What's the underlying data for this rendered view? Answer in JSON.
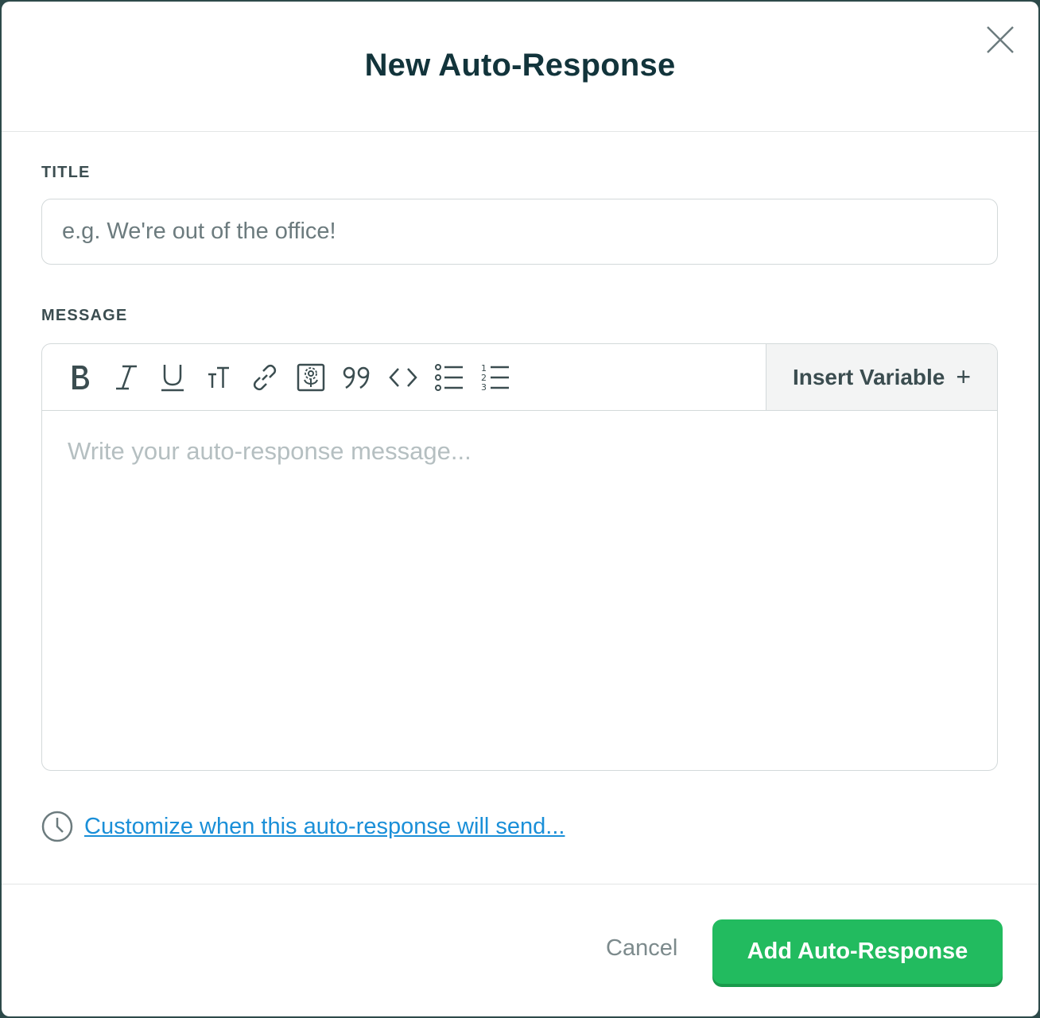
{
  "dialog": {
    "title": "New Auto-Response",
    "close_icon": "close-icon"
  },
  "title_field": {
    "label": "TITLE",
    "value": "",
    "placeholder": "e.g. We're out of the office!"
  },
  "message_field": {
    "label": "MESSAGE",
    "placeholder": "Write your auto-response message...",
    "toolbar": [
      {
        "name": "bold-icon"
      },
      {
        "name": "italic-icon"
      },
      {
        "name": "underline-icon"
      },
      {
        "name": "text-size-icon"
      },
      {
        "name": "link-icon"
      },
      {
        "name": "image-icon"
      },
      {
        "name": "quote-icon"
      },
      {
        "name": "code-icon"
      },
      {
        "name": "bullet-list-icon"
      },
      {
        "name": "numbered-list-icon"
      }
    ],
    "insert_variable": {
      "label": "Insert Variable",
      "plus": "+"
    }
  },
  "schedule": {
    "icon": "clock-icon",
    "link_text": "Customize when this auto-response will send..."
  },
  "footer": {
    "cancel_label": "Cancel",
    "submit_label": "Add Auto-Response"
  },
  "colors": {
    "title": "#12343b",
    "accent_green": "#22bb5f",
    "link_blue": "#1a8fd8",
    "border": "#d3d9da"
  }
}
